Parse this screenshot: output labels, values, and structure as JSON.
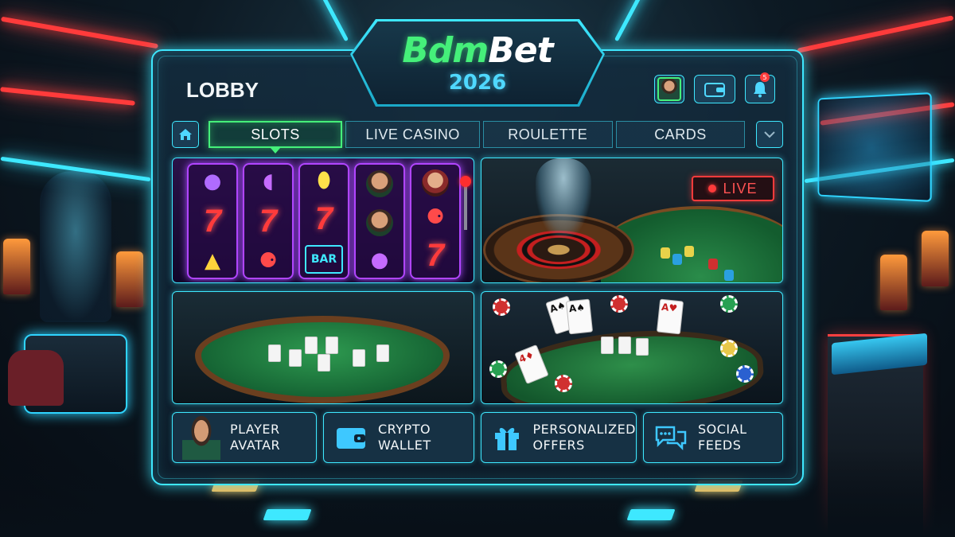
{
  "brand": {
    "name_part1": "Bdm",
    "name_part2": "Bet",
    "year": "2026"
  },
  "header": {
    "title": "LOBBY",
    "notification_count": "5",
    "icons": [
      "player-avatar-icon",
      "wallet-icon",
      "bell-icon"
    ]
  },
  "tabs": [
    {
      "label": "SLOTS",
      "active": true
    },
    {
      "label": "LIVE CASINO",
      "active": false
    },
    {
      "label": "ROULETTE",
      "active": false
    },
    {
      "label": "CARDS",
      "active": false
    }
  ],
  "games": {
    "slots": {
      "symbols_bar": "BAR",
      "symbol_seven": "7"
    },
    "live": {
      "badge": "LIVE"
    }
  },
  "features": [
    {
      "label": "PLAYER\nAVATAR",
      "icon": "avatar-icon"
    },
    {
      "label": "CRYPTO\nWALLET",
      "icon": "wallet-icon"
    },
    {
      "label": "PERSONALIZED\nOFFERS",
      "icon": "gift-icon"
    },
    {
      "label": "SOCIAL\nFEEDS",
      "icon": "chat-icon"
    }
  ],
  "colors": {
    "accent_cyan": "#3ee8ff",
    "accent_green": "#45f07a",
    "live_red": "#ff3b3b"
  }
}
